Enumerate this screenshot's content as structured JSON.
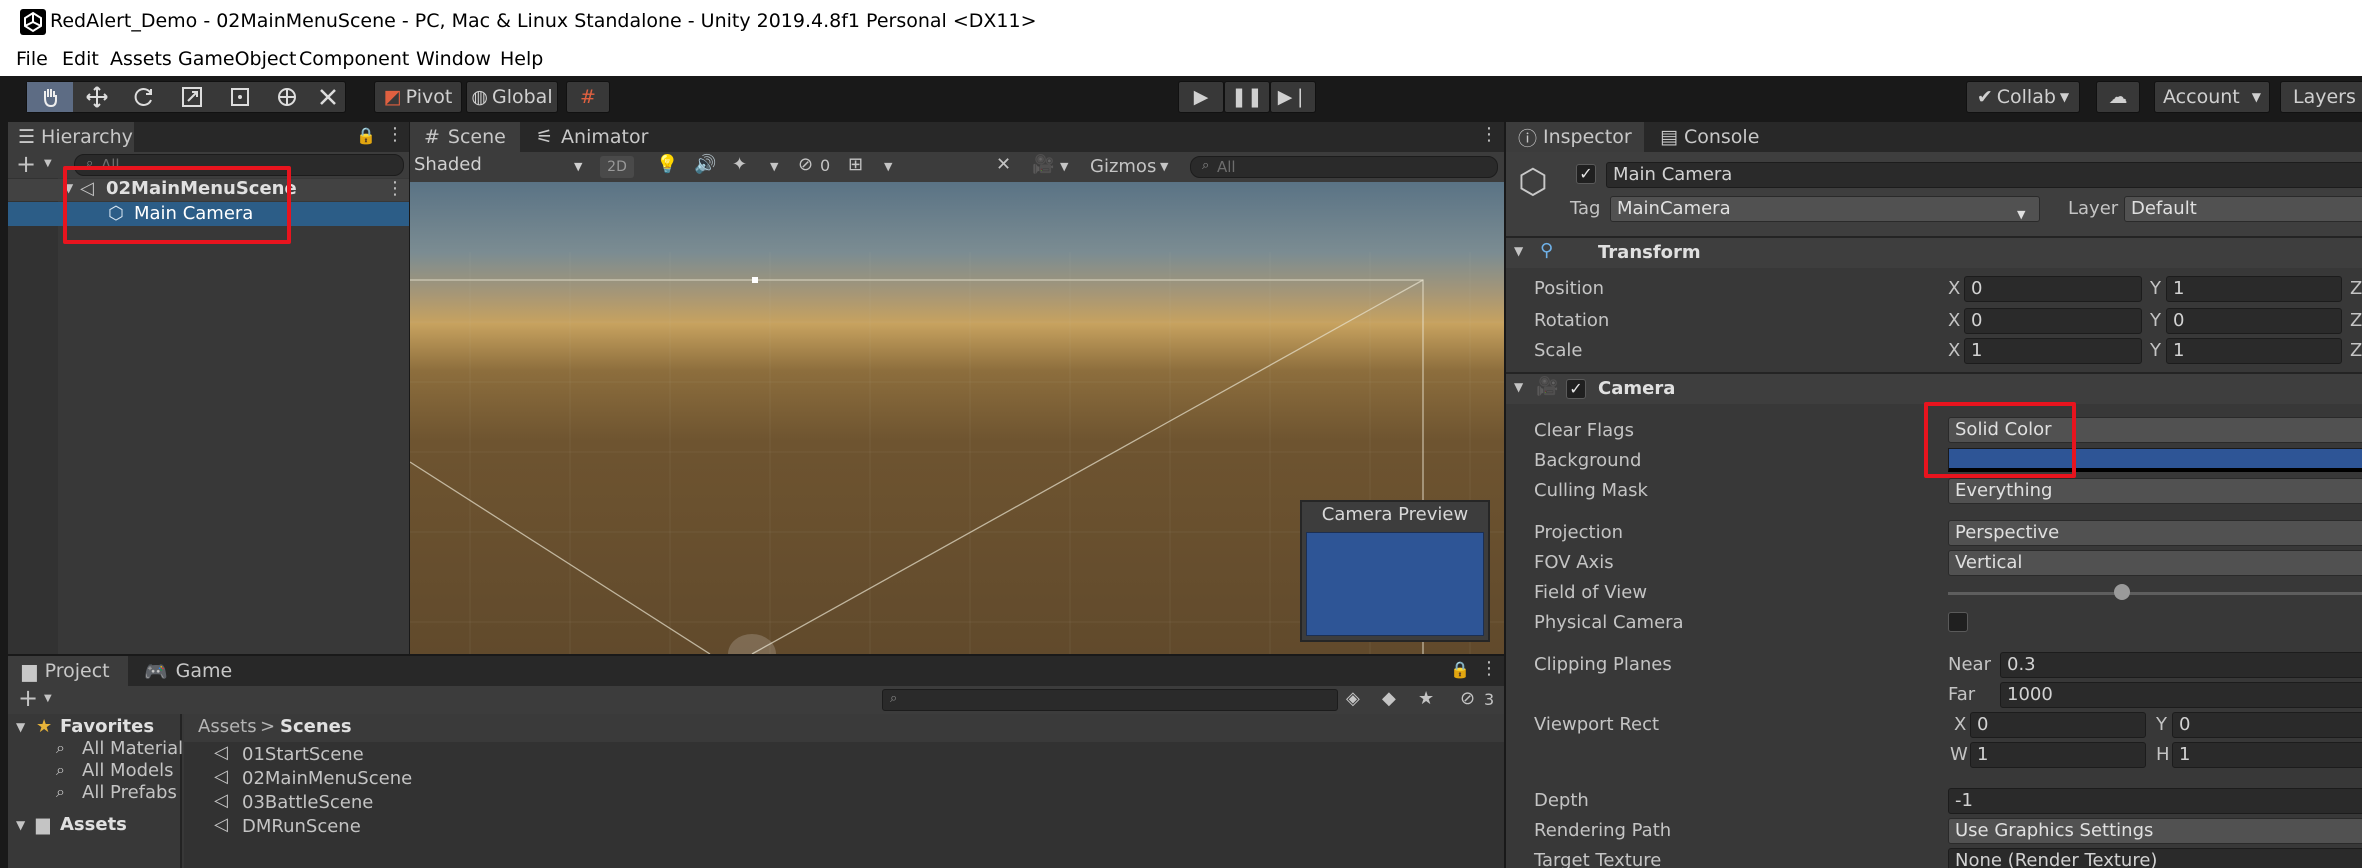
{
  "window": {
    "title": "RedAlert_Demo - 02MainMenuScene - PC, Mac & Linux Standalone - Unity 2019.4.8f1 Personal <DX11>"
  },
  "menu": [
    "File",
    "Edit",
    "Assets",
    "GameObject",
    "Component",
    "Window",
    "Help"
  ],
  "toolbar": {
    "pivot": "Pivot",
    "global": "Global",
    "collab": "Collab",
    "account": "Account",
    "layers": "Layers"
  },
  "hierarchy": {
    "tab": "Hierarchy",
    "search_placeholder": "All",
    "scene": "02MainMenuScene",
    "camera": "Main Camera"
  },
  "scene": {
    "tab_scene": "Scene",
    "tab_animator": "Animator",
    "shading": "Shaded",
    "mode2d": "2D",
    "hidden_count": "0",
    "gizmos": "Gizmos",
    "search_placeholder": "All",
    "preview_title": "Camera Preview"
  },
  "project": {
    "tab_project": "Project",
    "tab_game": "Game",
    "hidden_count": "3",
    "favorites": "Favorites",
    "fav_items": [
      "All Material",
      "All Models",
      "All Prefabs"
    ],
    "assets": "Assets",
    "breadcrumb_root": "Assets",
    "breadcrumb_current": "Scenes",
    "files": [
      "01StartScene",
      "02MainMenuScene",
      "03BattleScene",
      "DMRunScene"
    ]
  },
  "inspector": {
    "tab_inspector": "Inspector",
    "tab_console": "Console",
    "object_name": "Main Camera",
    "tag_label": "Tag",
    "tag_value": "MainCamera",
    "layer_label": "Layer",
    "layer_value": "Default",
    "transform": {
      "title": "Transform",
      "position": {
        "label": "Position",
        "x": "0",
        "y": "1"
      },
      "rotation": {
        "label": "Rotation",
        "x": "0",
        "y": "0"
      },
      "scale": {
        "label": "Scale",
        "x": "1",
        "y": "1"
      }
    },
    "camera": {
      "title": "Camera",
      "clear_flags": {
        "label": "Clear Flags",
        "value": "Solid Color"
      },
      "background": {
        "label": "Background",
        "color": "#2e5596"
      },
      "culling_mask": {
        "label": "Culling Mask",
        "value": "Everything"
      },
      "projection": {
        "label": "Projection",
        "value": "Perspective"
      },
      "fov_axis": {
        "label": "FOV Axis",
        "value": "Vertical"
      },
      "field_of_view": {
        "label": "Field of View"
      },
      "physical_camera": {
        "label": "Physical Camera"
      },
      "clipping": {
        "label": "Clipping Planes",
        "near_label": "Near",
        "near": "0.3",
        "far_label": "Far",
        "far": "1000"
      },
      "viewport": {
        "label": "Viewport Rect",
        "x": "0",
        "y": "0",
        "w": "1",
        "h": "1"
      },
      "depth": {
        "label": "Depth",
        "value": "-1"
      },
      "rendering_path": {
        "label": "Rendering Path",
        "value": "Use Graphics Settings"
      },
      "target_texture": {
        "label": "Target Texture",
        "value": "None (Render Texture)"
      }
    }
  },
  "axis": {
    "x": "X",
    "y": "Y",
    "z": "Z",
    "w": "W",
    "h": "H"
  }
}
